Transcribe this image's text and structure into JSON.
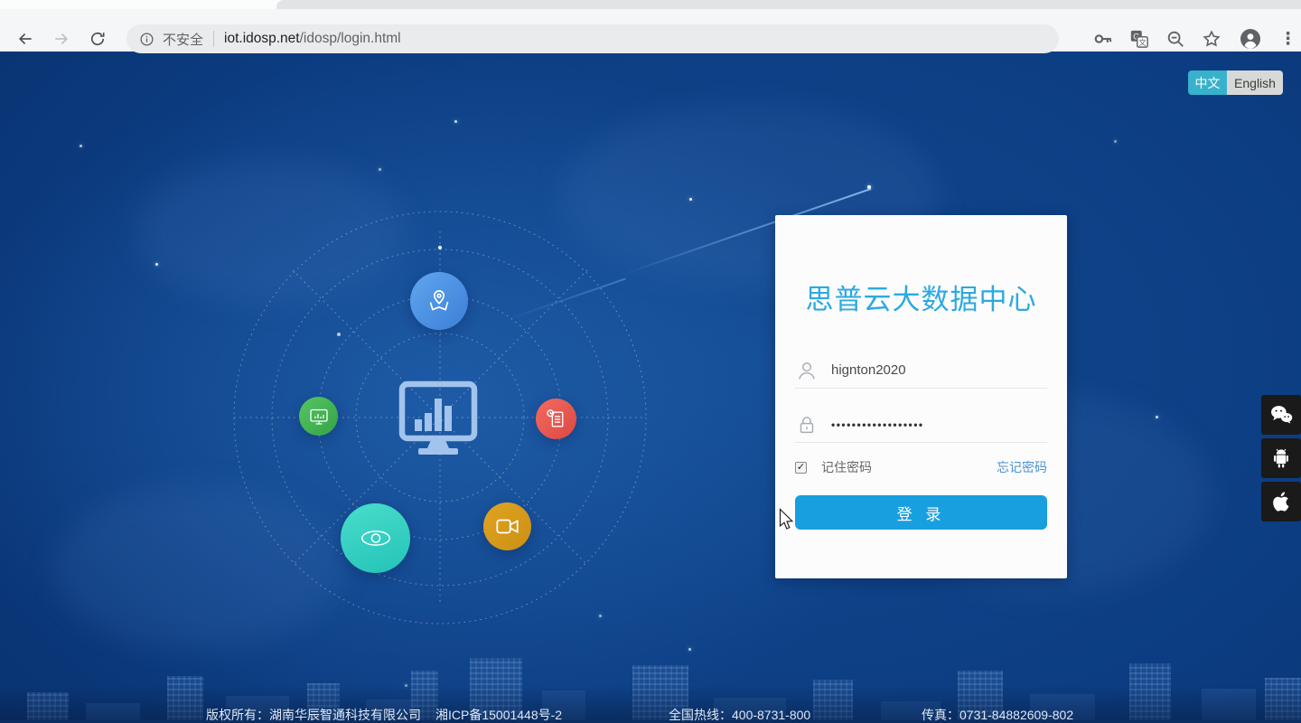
{
  "browser": {
    "security_label": "不安全",
    "url_host": "iot.idosp.net",
    "url_path": "/idosp/login.html"
  },
  "language_toggle": {
    "chinese": "中文",
    "english": "English"
  },
  "login_card": {
    "title": "思普云大数据中心",
    "username_value": "hignton2020",
    "password_value": "••••••••••••••••••",
    "remember_label": "记住密码",
    "remember_checked": "✓",
    "forgot_link": "忘记密码",
    "login_button": "登 录"
  },
  "footer": {
    "copyright": "版权所有：湖南华辰智通科技有限公司",
    "icp_number": "湘ICP备15001448号-2",
    "hotline": "全国热线：400-8731-800",
    "fax": "传真：0731-84882609-802"
  },
  "icons": {
    "menu_glyph": "⋮",
    "names": "back, forward, reload, info, key, translate, zoom-out, bookmark-star, profile, menu, user, lock, map-pin, monitor-chart, report-doc, eye, video-camera, wechat, android, apple"
  },
  "colors": {
    "accent_button_blue": "#189FE0",
    "title_blue": "#2BA9E1",
    "toggle_teal": "#38B1CC",
    "link_blue": "#4A93D4",
    "background_navy": "#0C3D82",
    "orbit_blue": "#3C7FD8",
    "orbit_green": "#33A348",
    "orbit_red": "#DC4842",
    "orbit_teal": "#23C3B8",
    "orbit_orange": "#CB8F13"
  }
}
